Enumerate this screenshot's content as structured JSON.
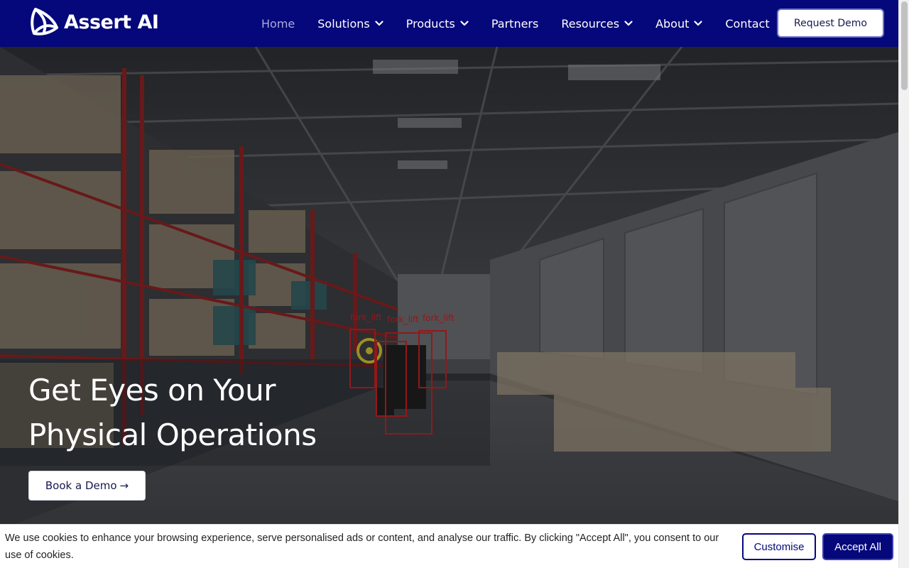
{
  "brand": {
    "name": "Assert AI",
    "color": "#05087a"
  },
  "nav": {
    "items": [
      {
        "label": "Home",
        "active": true,
        "dropdown": false
      },
      {
        "label": "Solutions",
        "active": false,
        "dropdown": true
      },
      {
        "label": "Products",
        "active": false,
        "dropdown": true
      },
      {
        "label": "Partners",
        "active": false,
        "dropdown": false
      },
      {
        "label": "Resources",
        "active": false,
        "dropdown": true
      },
      {
        "label": "About",
        "active": false,
        "dropdown": true
      },
      {
        "label": "Contact",
        "active": false,
        "dropdown": false
      }
    ],
    "cta_label": "Request Demo"
  },
  "hero": {
    "title_line1": "Get Eyes on Your",
    "title_line2": "Physical Operations",
    "button_label": "Book a Demo",
    "button_arrow": "→",
    "detection_labels": [
      "fork_lift",
      "fork_lift",
      "fork_lift"
    ],
    "detection_color": "#c81e1e"
  },
  "cookie": {
    "message": "We use cookies to enhance your browsing experience, serve personalised ads or content, and analyse our traffic. By clicking \"Accept All\", you consent to our use of cookies.",
    "customise_label": "Customise",
    "accept_label": "Accept All"
  }
}
